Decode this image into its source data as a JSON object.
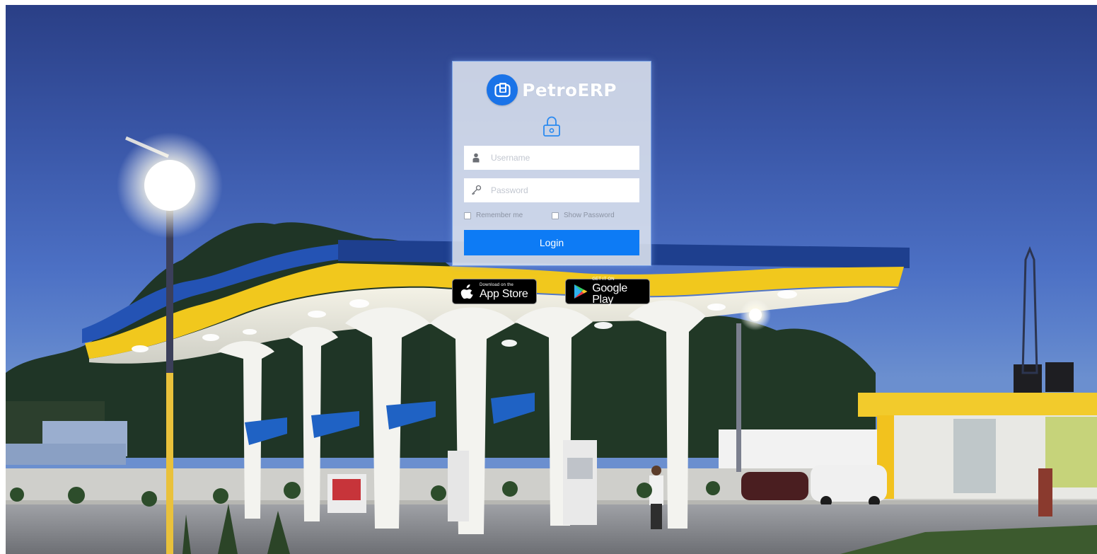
{
  "brand": {
    "name": "PetroERP",
    "logo_icon": "fuel-pump-icon",
    "color": "#1a73e8"
  },
  "login": {
    "lock_icon": "lock-icon",
    "username_placeholder": "Username",
    "username_icon": "user-icon",
    "password_placeholder": "Password",
    "password_icon": "key-icon",
    "remember_label": "Remember me",
    "show_password_label": "Show Password",
    "button_label": "Login",
    "button_color": "#0d7bf5"
  },
  "badges": {
    "apple": {
      "small": "Download on the",
      "big": "App Store",
      "icon": "apple-icon"
    },
    "google": {
      "small": "GET IT ON",
      "big": "Google Play",
      "icon": "google-play-icon"
    }
  }
}
